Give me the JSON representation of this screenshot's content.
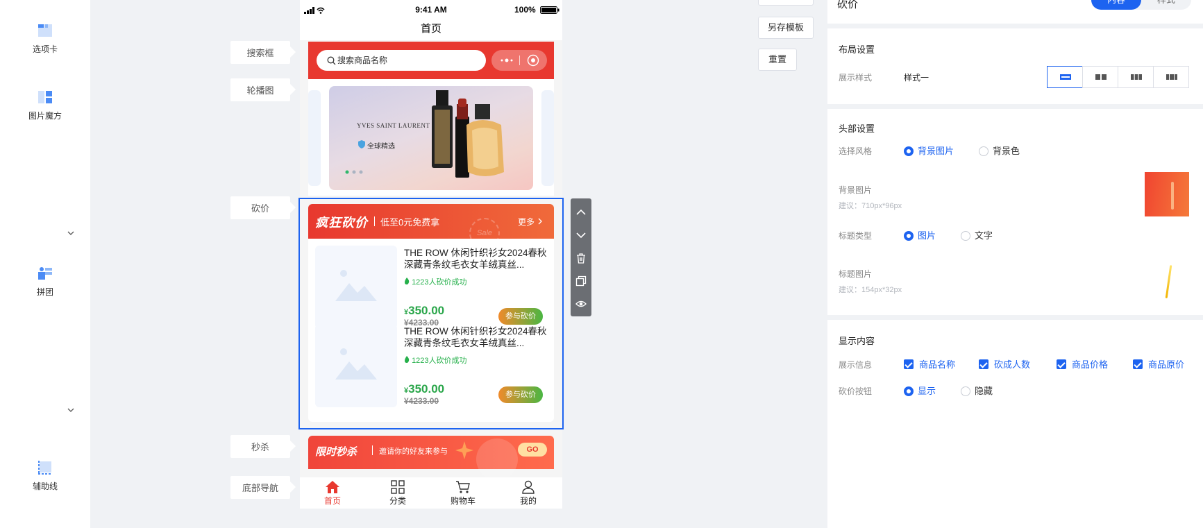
{
  "left_components": [
    {
      "label": "选项卡",
      "icon": "tab-icon"
    },
    {
      "label": "图片魔方",
      "icon": "image-cube-icon"
    },
    {
      "label": "拼团",
      "icon": "group-buy-icon"
    },
    {
      "label": "辅助线",
      "icon": "guide-line-icon"
    }
  ],
  "canvas_labels": {
    "search": "搜索框",
    "banner": "轮播图",
    "bargain": "砍价",
    "seckill": "秒杀",
    "tabbar": "底部导航"
  },
  "phone": {
    "time": "9:41 AM",
    "battery": "100%",
    "title": "首页",
    "search_placeholder": "搜索商品名称",
    "banner": {
      "brand": "YVES SAINT LAURENT",
      "tag": "全球精选"
    },
    "bargain": {
      "header_title": "疯狂砍价",
      "header_sub": "低至0元免费拿",
      "more": "更多",
      "sale_stamp": "Sale",
      "items": [
        {
          "title": "THE ROW 休闲针织衫女2024春秋深藏青条纹毛衣女羊绒真丝...",
          "sold": "1223人砍价成功",
          "currency": "¥",
          "price": "350.00",
          "original_price": "¥4233.00",
          "button": "参与砍价"
        },
        {
          "title": "THE ROW 休闲针织衫女2024春秋深藏青条纹毛衣女羊绒真丝...",
          "sold": "1223人砍价成功",
          "currency": "¥",
          "price": "350.00",
          "original_price": "¥4233.00",
          "button": "参与砍价"
        }
      ]
    },
    "seckill": {
      "title": "限时秒杀",
      "sub": "邀请你的好友来参与",
      "go": "GO"
    },
    "tabbar": [
      {
        "label": "首页",
        "icon": "home-icon",
        "active": true
      },
      {
        "label": "分类",
        "icon": "category-icon",
        "active": false
      },
      {
        "label": "购物车",
        "icon": "cart-icon",
        "active": false
      },
      {
        "label": "我的",
        "icon": "user-icon",
        "active": false
      }
    ]
  },
  "actions": {
    "save_template": "另存模板",
    "reset": "重置"
  },
  "settings": {
    "header_title": "砍价",
    "tab_content": "内容",
    "tab_style": "样式",
    "layout": {
      "title": "布局设置",
      "display_style_label": "展示样式",
      "display_style_value": "样式一",
      "selected_option_index": 0
    },
    "head": {
      "title": "头部设置",
      "style_label": "选择风格",
      "style_options": [
        "背景图片",
        "背景色"
      ],
      "style_selected": "背景图片",
      "bg_image_label": "背景图片",
      "bg_image_hint": "建议：710px*96px",
      "title_type_label": "标题类型",
      "title_type_options": [
        "图片",
        "文字"
      ],
      "title_type_selected": "图片",
      "title_image_label": "标题图片",
      "title_image_hint": "建议：154px*32px"
    },
    "display": {
      "title": "显示内容",
      "info_label": "展示信息",
      "info_options": [
        "商品名称",
        "砍成人数",
        "商品价格",
        "商品原价"
      ],
      "button_label": "砍价按钮",
      "button_options": [
        "显示",
        "隐藏"
      ],
      "button_selected": "显示"
    }
  },
  "colors": {
    "accent": "#1d63f0",
    "brand_red": "#e8382f",
    "green": "#2aa64a"
  }
}
